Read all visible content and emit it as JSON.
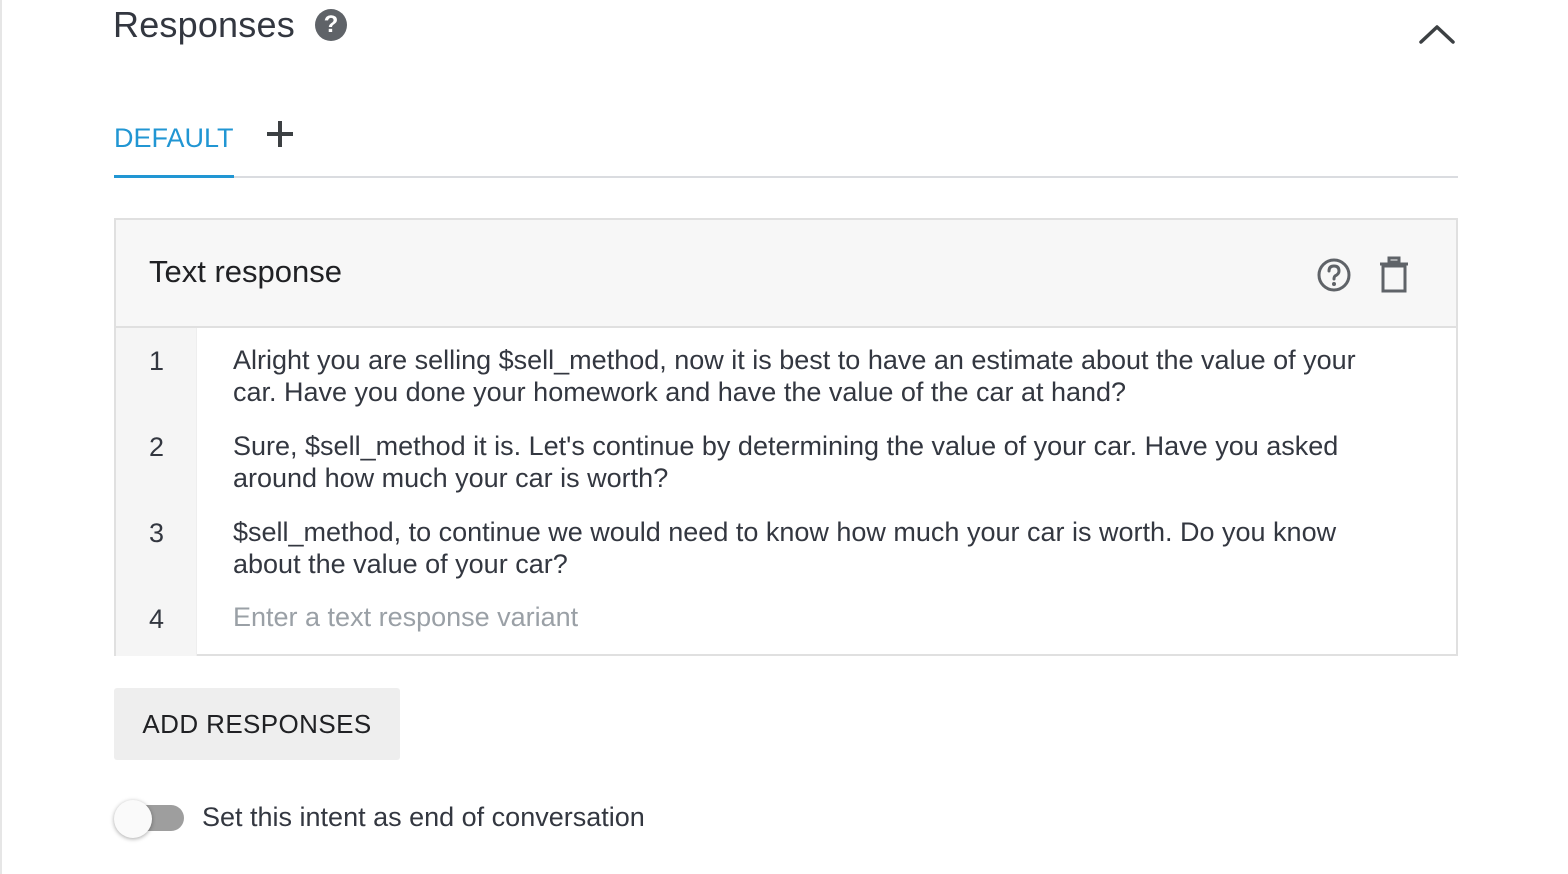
{
  "section": {
    "title": "Responses",
    "help_icon": "question-circle-icon",
    "collapse_icon": "chevron-up-icon"
  },
  "tabs": {
    "items": [
      {
        "label": "DEFAULT",
        "active": true
      }
    ],
    "add_icon": "plus-icon"
  },
  "card": {
    "title": "Text response",
    "help_icon": "question-circle-outline-icon",
    "delete_icon": "trash-icon",
    "rows": [
      {
        "num": "1",
        "text": "Alright you are selling $sell_method, now it is best to have an estimate about the value of your car. Have you done your homework and have the value of the car at hand?"
      },
      {
        "num": "2",
        "text": "Sure, $sell_method it is. Let's continue by determining the value of your car. Have you asked around how much your car is worth?"
      },
      {
        "num": "3",
        "text": "$sell_method, to continue we would need to know how much your car is worth. Do you know about the value of your car?"
      },
      {
        "num": "4",
        "text": ""
      }
    ],
    "new_row_placeholder": "Enter a text response variant"
  },
  "add_responses_label": "ADD RESPONSES",
  "end_conversation": {
    "label": "Set this intent as end of conversation",
    "enabled": false
  },
  "colors": {
    "accent": "#2196d3",
    "text": "#333740",
    "placeholder": "#9aa0a6",
    "header_bg": "#f7f7f7"
  }
}
